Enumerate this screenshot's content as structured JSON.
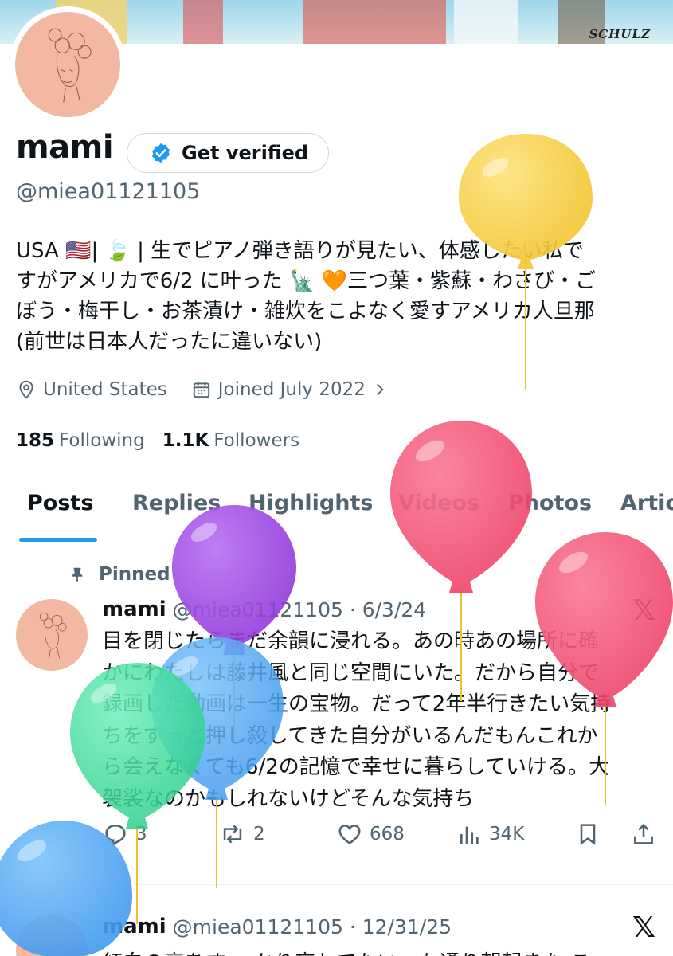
{
  "banner": {
    "signature": "SCHULZ"
  },
  "profile": {
    "name": "mami",
    "verify_label": "Get verified",
    "handle": "@miea01121105",
    "bio_lines": [
      "USA 🇺🇸| 🍃 | 生でピアノ弾き語りが見たい、体感したい私で",
      "すがアメリカで6/2 に叶った 🗽 🧡三つ葉・紫蘇・わさび・ご",
      "ぼう・梅干し・お茶漬け・雑炊をこよなく愛すアメリカ人旦那",
      "(前世は日本人だったに違いない)"
    ],
    "location": "United States",
    "joined": "Joined July 2022",
    "following_count": "185",
    "following_label": "Following",
    "followers_count": "1.1K",
    "followers_label": "Followers"
  },
  "tabs": [
    "Posts",
    "Replies",
    "Highlights",
    "Videos",
    "Photos",
    "Artic"
  ],
  "pinned_label": "Pinned",
  "posts": [
    {
      "name": "mami",
      "meta": "@miea01121105 · 6/3/24",
      "text_lines": [
        "目を閉じたらまだ余韻に浸れる。あの時あの場所に確",
        "かにわたしは藤井風と同じ空間にいた。だから自分で",
        "録画した動画は一生の宝物。だって2年半行きたい気持",
        "ちをずっと押し殺してきた自分がいるんだもんこれか",
        "ら会えなくても6/2の記憶で幸せに暮らしていける。大",
        "袈裟なのかもしれないけどそんな気持ち"
      ],
      "replies": "3",
      "reposts": "2",
      "likes": "668",
      "views": "34K"
    },
    {
      "name": "mami",
      "meta": "@miea01121105 · 12/31/25",
      "text": "紅白の裏をす っかり忘れてたいつも通り朝起きた こ"
    }
  ],
  "icons": {
    "verified": "verified-badge-icon",
    "location": "location-pin-icon",
    "calendar": "calendar-icon",
    "chevron": "chevron-right-icon",
    "pin": "pin-icon",
    "x_logo": "x-logo-icon",
    "reply": "reply-icon",
    "repost": "repost-icon",
    "like": "like-icon",
    "views": "views-icon",
    "bookmark": "bookmark-icon",
    "share": "share-icon"
  },
  "colors": {
    "accent": "#1d9bf0",
    "secondary_text": "#536471",
    "avatar_bg": "#f3b8a1",
    "balloon_yellow": "#f5c93a",
    "balloon_pink": "#f0496f",
    "balloon_purple": "#9b3fe0",
    "balloon_blue": "#4fa8f2",
    "balloon_green": "#3fd99a"
  }
}
